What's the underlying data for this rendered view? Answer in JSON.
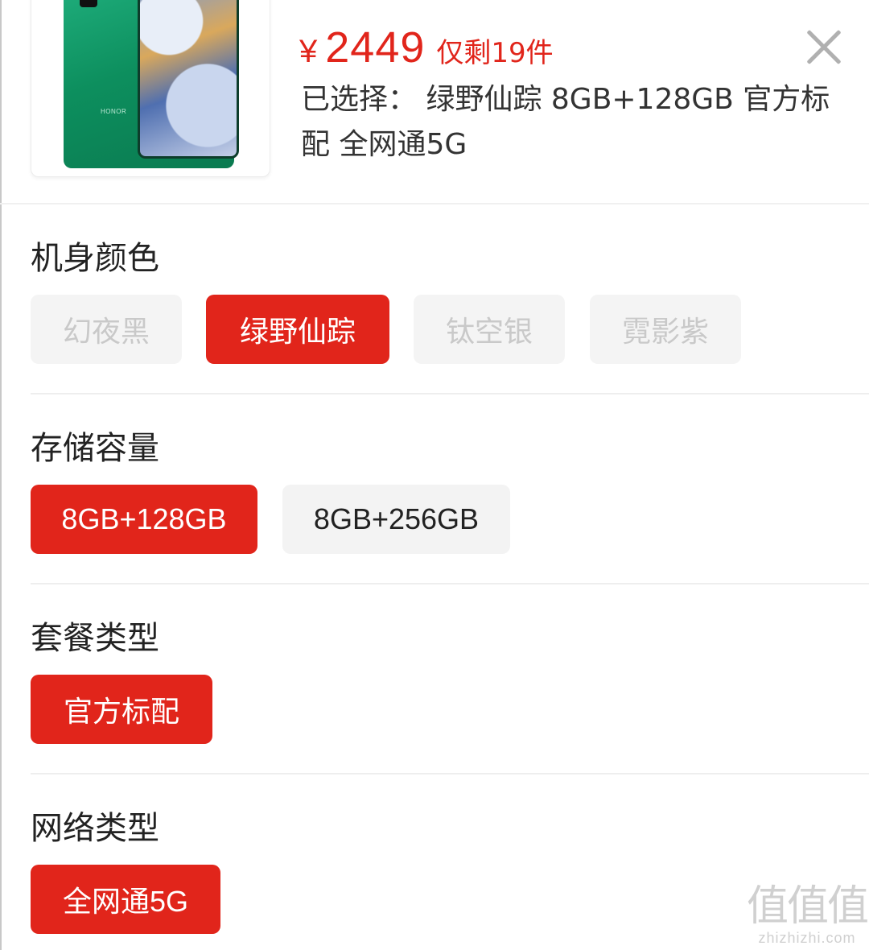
{
  "header": {
    "price_symbol": "¥",
    "price_value": "2449",
    "stock_text": "仅剩19件",
    "selected_text": "已选择： 绿野仙踪 8GB+128GB 官方标配 全网通5G",
    "product_image_icon": "honor-phone-image",
    "product_logo_text": "HONOR",
    "close_icon": "close-icon"
  },
  "groups": [
    {
      "title": "机身颜色",
      "options": [
        {
          "label": "幻夜黑",
          "state": "disabled"
        },
        {
          "label": "绿野仙踪",
          "state": "selected"
        },
        {
          "label": "钛空银",
          "state": "disabled"
        },
        {
          "label": "霓影紫",
          "state": "disabled"
        }
      ]
    },
    {
      "title": "存储容量",
      "options": [
        {
          "label": "8GB+128GB",
          "state": "selected"
        },
        {
          "label": "8GB+256GB",
          "state": "normal"
        }
      ]
    },
    {
      "title": "套餐类型",
      "options": [
        {
          "label": "官方标配",
          "state": "selected"
        }
      ]
    },
    {
      "title": "网络类型",
      "options": [
        {
          "label": "全网通5G",
          "state": "selected"
        }
      ]
    }
  ],
  "watermark": {
    "big": "值值值",
    "small": "zhizhizhi.com"
  },
  "colors": {
    "accent": "#e1251b",
    "option_bg": "#f3f3f3",
    "disabled_text": "#c9c9c9"
  }
}
